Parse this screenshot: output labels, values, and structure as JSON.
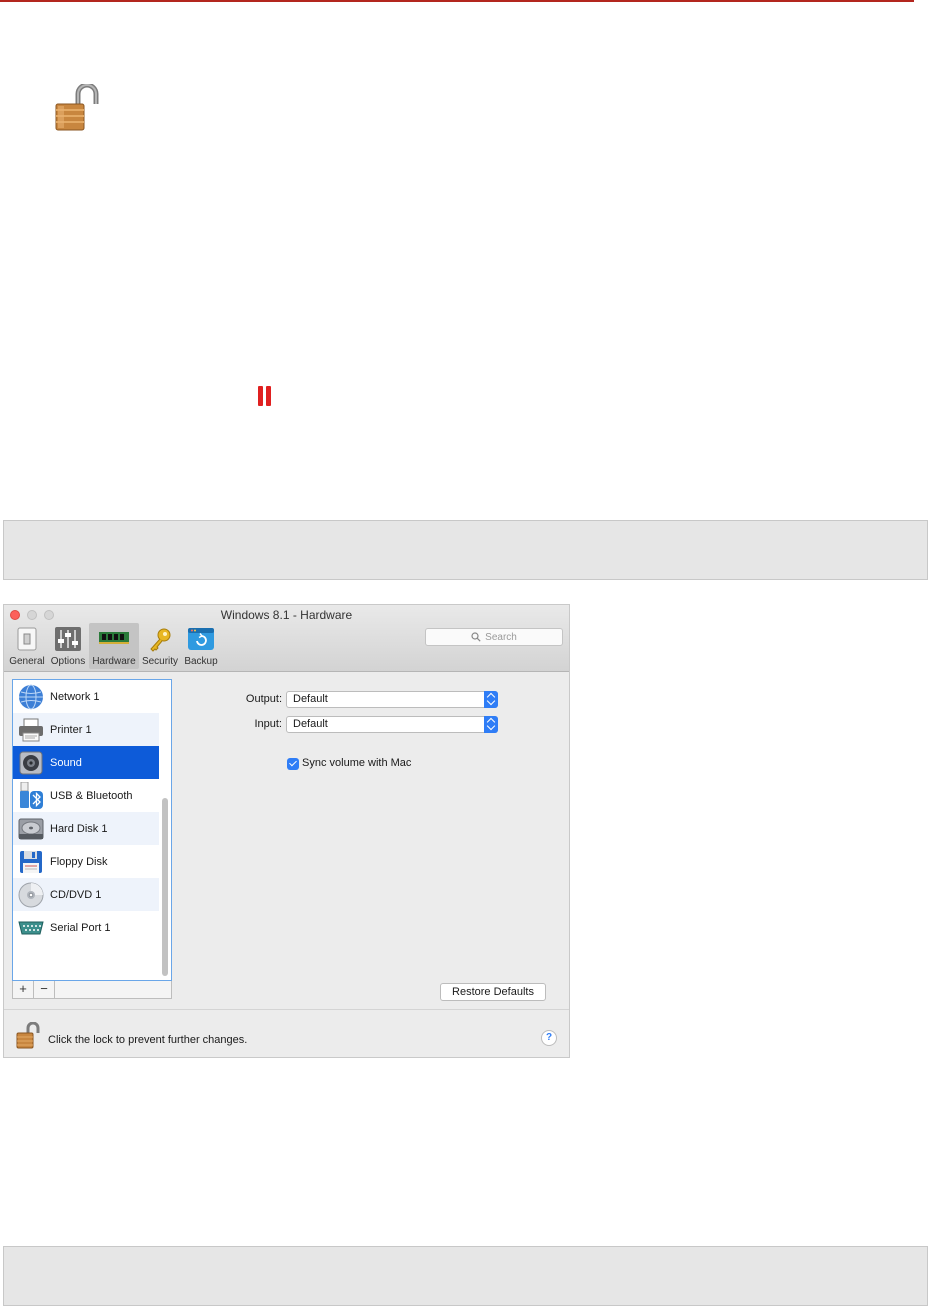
{
  "window": {
    "title": "Windows 8.1 - Hardware",
    "search_placeholder": "Search",
    "toolbar": [
      {
        "label": "General",
        "icon": "general-switch-icon"
      },
      {
        "label": "Options",
        "icon": "options-sliders-icon"
      },
      {
        "label": "Hardware",
        "icon": "hardware-ram-icon",
        "active": true
      },
      {
        "label": "Security",
        "icon": "security-key-icon"
      },
      {
        "label": "Backup",
        "icon": "backup-icon"
      }
    ]
  },
  "devices": {
    "items": [
      {
        "label": "Network 1",
        "icon": "network-globe-icon"
      },
      {
        "label": "Printer 1",
        "icon": "printer-icon"
      },
      {
        "label": "Sound",
        "icon": "sound-speaker-icon",
        "selected": true
      },
      {
        "label": "USB & Bluetooth",
        "icon": "usb-bluetooth-icon"
      },
      {
        "label": "Hard Disk 1",
        "icon": "hard-disk-icon"
      },
      {
        "label": "Floppy Disk",
        "icon": "floppy-disk-icon"
      },
      {
        "label": "CD/DVD 1",
        "icon": "cd-dvd-icon"
      },
      {
        "label": "Serial Port 1",
        "icon": "serial-port-icon"
      }
    ],
    "add_label": "+",
    "remove_label": "−"
  },
  "sound": {
    "output_label": "Output:",
    "output_value": "Default",
    "input_label": "Input:",
    "input_value": "Default",
    "sync_label": "Sync volume with Mac",
    "sync_checked": true,
    "restore_label": "Restore Defaults"
  },
  "footer": {
    "lock_text": "Click the lock to prevent further changes.",
    "help_label": "?"
  },
  "colors": {
    "accent_rule": "#b3261e",
    "selection": "#0d5bd9",
    "pause": "#e02020"
  }
}
